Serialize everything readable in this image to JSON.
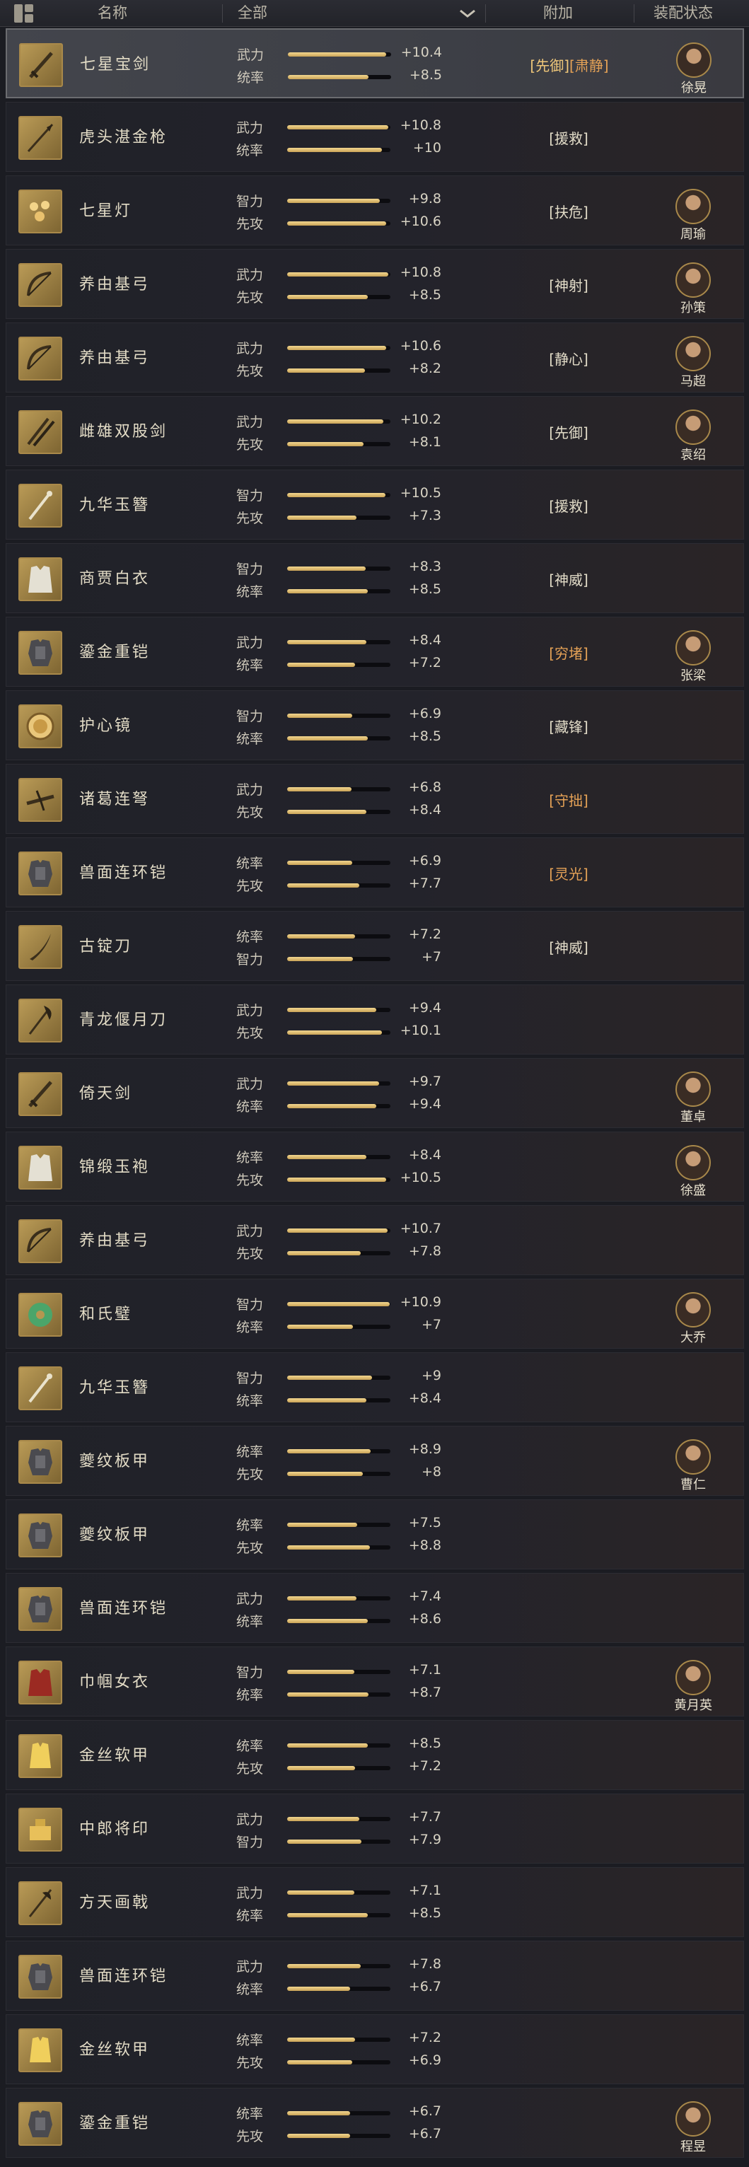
{
  "header": {
    "name_label": "名称",
    "filter_label": "全部",
    "extra_label": "附加",
    "status_label": "装配状态"
  },
  "colors": {
    "skill_default": "#e2dcc8",
    "skill_special": "#e5a256",
    "bar_fill": "#e8c879"
  },
  "items": [
    {
      "name": "七星宝剑",
      "icon": "sword-icon",
      "stats": [
        {
          "label": "武力",
          "value": "+10.4",
          "fill": 0.95
        },
        {
          "label": "统率",
          "value": "+8.5",
          "fill": 0.78
        }
      ],
      "skills": [
        {
          "text": "[先御]",
          "color": "#f0c87a"
        },
        {
          "text": "[肃静]",
          "color": "#e5a256"
        }
      ],
      "owner": "徐晃"
    },
    {
      "name": "虎头湛金枪",
      "icon": "spear-icon",
      "stats": [
        {
          "label": "武力",
          "value": "+10.8",
          "fill": 0.98
        },
        {
          "label": "统率",
          "value": "+10",
          "fill": 0.92
        }
      ],
      "skills": [
        {
          "text": "[援救]",
          "color": "#e2dcc8"
        }
      ],
      "owner": ""
    },
    {
      "name": "七星灯",
      "icon": "lamp-icon",
      "stats": [
        {
          "label": "智力",
          "value": "+9.8",
          "fill": 0.9
        },
        {
          "label": "先攻",
          "value": "+10.6",
          "fill": 0.96
        }
      ],
      "skills": [
        {
          "text": "[扶危]",
          "color": "#e2dcc8"
        }
      ],
      "owner": "周瑜"
    },
    {
      "name": "养由基弓",
      "icon": "bow-icon",
      "stats": [
        {
          "label": "武力",
          "value": "+10.8",
          "fill": 0.98
        },
        {
          "label": "先攻",
          "value": "+8.5",
          "fill": 0.78
        }
      ],
      "skills": [
        {
          "text": "[神射]",
          "color": "#e2dcc8"
        }
      ],
      "owner": "孙策"
    },
    {
      "name": "养由基弓",
      "icon": "bow-icon",
      "stats": [
        {
          "label": "武力",
          "value": "+10.6",
          "fill": 0.96
        },
        {
          "label": "先攻",
          "value": "+8.2",
          "fill": 0.75
        }
      ],
      "skills": [
        {
          "text": "[静心]",
          "color": "#e2dcc8"
        }
      ],
      "owner": "马超"
    },
    {
      "name": "雌雄双股剑",
      "icon": "twin-sword-icon",
      "stats": [
        {
          "label": "武力",
          "value": "+10.2",
          "fill": 0.93
        },
        {
          "label": "先攻",
          "value": "+8.1",
          "fill": 0.74
        }
      ],
      "skills": [
        {
          "text": "[先御]",
          "color": "#e2dcc8"
        }
      ],
      "owner": "袁绍"
    },
    {
      "name": "九华玉簪",
      "icon": "hairpin-icon",
      "stats": [
        {
          "label": "智力",
          "value": "+10.5",
          "fill": 0.95
        },
        {
          "label": "先攻",
          "value": "+7.3",
          "fill": 0.67
        }
      ],
      "skills": [
        {
          "text": "[援救]",
          "color": "#e2dcc8"
        }
      ],
      "owner": ""
    },
    {
      "name": "商贾白衣",
      "icon": "robe-icon",
      "stats": [
        {
          "label": "智力",
          "value": "+8.3",
          "fill": 0.76
        },
        {
          "label": "统率",
          "value": "+8.5",
          "fill": 0.78
        }
      ],
      "skills": [
        {
          "text": "[神威]",
          "color": "#e2dcc8"
        }
      ],
      "owner": ""
    },
    {
      "name": "鎏金重铠",
      "icon": "armor-icon",
      "stats": [
        {
          "label": "武力",
          "value": "+8.4",
          "fill": 0.77
        },
        {
          "label": "统率",
          "value": "+7.2",
          "fill": 0.66
        }
      ],
      "skills": [
        {
          "text": "[穷堵]",
          "color": "#e5a256"
        }
      ],
      "owner": "张梁"
    },
    {
      "name": "护心镜",
      "icon": "mirror-icon",
      "stats": [
        {
          "label": "智力",
          "value": "+6.9",
          "fill": 0.63
        },
        {
          "label": "统率",
          "value": "+8.5",
          "fill": 0.78
        }
      ],
      "skills": [
        {
          "text": "[藏锋]",
          "color": "#e2dcc8"
        }
      ],
      "owner": ""
    },
    {
      "name": "诸葛连弩",
      "icon": "crossbow-icon",
      "stats": [
        {
          "label": "武力",
          "value": "+6.8",
          "fill": 0.62
        },
        {
          "label": "先攻",
          "value": "+8.4",
          "fill": 0.77
        }
      ],
      "skills": [
        {
          "text": "[守拙]",
          "color": "#e5a256"
        }
      ],
      "owner": ""
    },
    {
      "name": "兽面连环铠",
      "icon": "armor-icon",
      "stats": [
        {
          "label": "统率",
          "value": "+6.9",
          "fill": 0.63
        },
        {
          "label": "先攻",
          "value": "+7.7",
          "fill": 0.7
        }
      ],
      "skills": [
        {
          "text": "[灵光]",
          "color": "#e5a256"
        }
      ],
      "owner": ""
    },
    {
      "name": "古锭刀",
      "icon": "saber-icon",
      "stats": [
        {
          "label": "统率",
          "value": "+7.2",
          "fill": 0.66
        },
        {
          "label": "智力",
          "value": "+7",
          "fill": 0.64
        }
      ],
      "skills": [
        {
          "text": "[神威]",
          "color": "#e2dcc8"
        }
      ],
      "owner": ""
    },
    {
      "name": "青龙偃月刀",
      "icon": "glaive-icon",
      "stats": [
        {
          "label": "武力",
          "value": "+9.4",
          "fill": 0.86
        },
        {
          "label": "先攻",
          "value": "+10.1",
          "fill": 0.92
        }
      ],
      "skills": [],
      "owner": ""
    },
    {
      "name": "倚天剑",
      "icon": "sword-icon",
      "stats": [
        {
          "label": "武力",
          "value": "+9.7",
          "fill": 0.89
        },
        {
          "label": "统率",
          "value": "+9.4",
          "fill": 0.86
        }
      ],
      "skills": [],
      "owner": "董卓"
    },
    {
      "name": "锦缎玉袍",
      "icon": "robe-icon",
      "stats": [
        {
          "label": "统率",
          "value": "+8.4",
          "fill": 0.77
        },
        {
          "label": "先攻",
          "value": "+10.5",
          "fill": 0.96
        }
      ],
      "skills": [],
      "owner": "徐盛"
    },
    {
      "name": "养由基弓",
      "icon": "bow-icon",
      "stats": [
        {
          "label": "武力",
          "value": "+10.7",
          "fill": 0.97
        },
        {
          "label": "先攻",
          "value": "+7.8",
          "fill": 0.71
        }
      ],
      "skills": [],
      "owner": ""
    },
    {
      "name": "和氏璧",
      "icon": "jade-disc-icon",
      "stats": [
        {
          "label": "智力",
          "value": "+10.9",
          "fill": 0.99
        },
        {
          "label": "统率",
          "value": "+7",
          "fill": 0.64
        }
      ],
      "skills": [],
      "owner": "大乔"
    },
    {
      "name": "九华玉簪",
      "icon": "hairpin-icon",
      "stats": [
        {
          "label": "智力",
          "value": "+9",
          "fill": 0.82
        },
        {
          "label": "统率",
          "value": "+8.4",
          "fill": 0.77
        }
      ],
      "skills": [],
      "owner": ""
    },
    {
      "name": "夔纹板甲",
      "icon": "armor-icon",
      "stats": [
        {
          "label": "统率",
          "value": "+8.9",
          "fill": 0.81
        },
        {
          "label": "先攻",
          "value": "+8",
          "fill": 0.73
        }
      ],
      "skills": [],
      "owner": "曹仁"
    },
    {
      "name": "夔纹板甲",
      "icon": "armor-icon",
      "stats": [
        {
          "label": "统率",
          "value": "+7.5",
          "fill": 0.68
        },
        {
          "label": "先攻",
          "value": "+8.8",
          "fill": 0.8
        }
      ],
      "skills": [],
      "owner": ""
    },
    {
      "name": "兽面连环铠",
      "icon": "armor-icon",
      "stats": [
        {
          "label": "武力",
          "value": "+7.4",
          "fill": 0.67
        },
        {
          "label": "统率",
          "value": "+8.6",
          "fill": 0.78
        }
      ],
      "skills": [],
      "owner": ""
    },
    {
      "name": "巾帼女衣",
      "icon": "red-robe-icon",
      "stats": [
        {
          "label": "智力",
          "value": "+7.1",
          "fill": 0.65
        },
        {
          "label": "统率",
          "value": "+8.7",
          "fill": 0.79
        }
      ],
      "skills": [],
      "owner": "黄月英"
    },
    {
      "name": "金丝软甲",
      "icon": "gold-vest-icon",
      "stats": [
        {
          "label": "统率",
          "value": "+8.5",
          "fill": 0.78
        },
        {
          "label": "先攻",
          "value": "+7.2",
          "fill": 0.66
        }
      ],
      "skills": [],
      "owner": ""
    },
    {
      "name": "中郎将印",
      "icon": "seal-icon",
      "stats": [
        {
          "label": "武力",
          "value": "+7.7",
          "fill": 0.7
        },
        {
          "label": "智力",
          "value": "+7.9",
          "fill": 0.72
        }
      ],
      "skills": [],
      "owner": ""
    },
    {
      "name": "方天画戟",
      "icon": "halberd-icon",
      "stats": [
        {
          "label": "武力",
          "value": "+7.1",
          "fill": 0.65
        },
        {
          "label": "统率",
          "value": "+8.5",
          "fill": 0.78
        }
      ],
      "skills": [],
      "owner": ""
    },
    {
      "name": "兽面连环铠",
      "icon": "armor-icon",
      "stats": [
        {
          "label": "武力",
          "value": "+7.8",
          "fill": 0.71
        },
        {
          "label": "统率",
          "value": "+6.7",
          "fill": 0.61
        }
      ],
      "skills": [],
      "owner": ""
    },
    {
      "name": "金丝软甲",
      "icon": "gold-vest-icon",
      "stats": [
        {
          "label": "统率",
          "value": "+7.2",
          "fill": 0.66
        },
        {
          "label": "先攻",
          "value": "+6.9",
          "fill": 0.63
        }
      ],
      "skills": [],
      "owner": ""
    },
    {
      "name": "鎏金重铠",
      "icon": "armor-icon",
      "stats": [
        {
          "label": "统率",
          "value": "+6.7",
          "fill": 0.61
        },
        {
          "label": "先攻",
          "value": "+6.7",
          "fill": 0.61
        }
      ],
      "skills": [],
      "owner": "程昱"
    }
  ]
}
